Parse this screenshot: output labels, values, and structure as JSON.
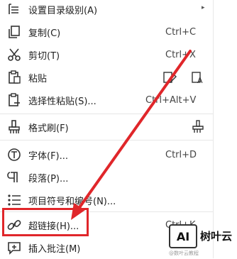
{
  "menu": {
    "items": [
      {
        "label": "设置目录级别(A)",
        "shortcut": "",
        "icon": "toc-level-icon"
      },
      {
        "label": "复制(C)",
        "shortcut": "Ctrl+C",
        "icon": "copy-icon"
      },
      {
        "label": "剪切(T)",
        "shortcut": "Ctrl+X",
        "icon": "scissors-icon"
      },
      {
        "label": "粘贴",
        "shortcut": "",
        "icon": "paste-icon"
      },
      {
        "label": "选择性粘贴(S)...",
        "shortcut": "Ctrl+Alt+V",
        "icon": "paste-special-icon"
      },
      {
        "label": "格式刷(F)",
        "shortcut": "",
        "icon": "format-brush-icon"
      },
      {
        "label": "字体(F)...",
        "shortcut": "Ctrl+D",
        "icon": "font-icon"
      },
      {
        "label": "段落(P)...",
        "shortcut": "",
        "icon": "paragraph-icon"
      },
      {
        "label": "项目符号和编号(N)...",
        "shortcut": "",
        "icon": "bullet-list-icon"
      },
      {
        "label": "超链接(H)...",
        "shortcut": "Ctrl+K",
        "icon": "hyperlink-icon"
      },
      {
        "label": "插入批注(M)",
        "shortcut": "",
        "icon": "insert-comment-icon"
      }
    ]
  },
  "watermark": {
    "logo": "AI",
    "text": "树叶云",
    "sub": "@数叶云教程"
  },
  "colors": {
    "highlight": "#e0262a",
    "arrow": "#e0262a"
  }
}
